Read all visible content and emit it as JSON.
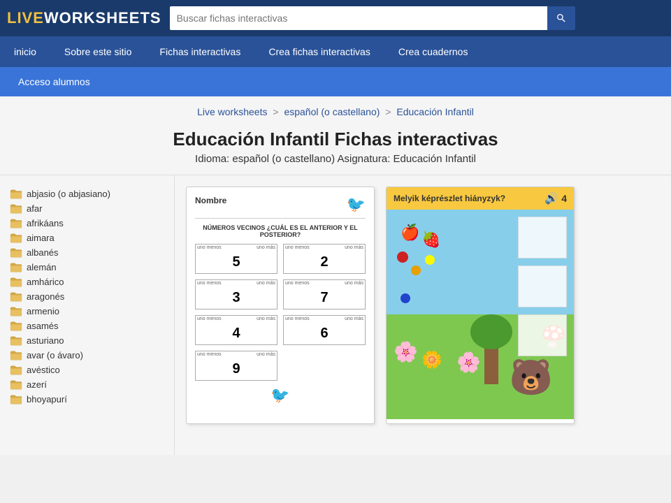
{
  "header": {
    "logo_live": "LIVE",
    "logo_rest": "WORKSHEETS",
    "search_placeholder": "Buscar fichas interactivas"
  },
  "nav": {
    "items": [
      {
        "label": "inicio"
      },
      {
        "label": "Sobre este sitio"
      },
      {
        "label": "Fichas interactivas"
      },
      {
        "label": "Crea fichas interactivas"
      },
      {
        "label": "Crea cuadernos"
      }
    ]
  },
  "acceso": {
    "label": "Acceso alumnos"
  },
  "breadcrumb": {
    "live_worksheets": "Live worksheets",
    "separator1": ">",
    "espanol": "español (o castellano)",
    "separator2": ">",
    "educacion": "Educación Infantil"
  },
  "page": {
    "title": "Educación Infantil Fichas interactivas",
    "subtitle": "Idioma: español (o castellano)   Asignatura: Educación Infantil"
  },
  "sidebar": {
    "items": [
      {
        "label": "abjasio (o abjasiano)"
      },
      {
        "label": "afar"
      },
      {
        "label": "afrikáans"
      },
      {
        "label": "aimara"
      },
      {
        "label": "albanés"
      },
      {
        "label": "alemán"
      },
      {
        "label": "amhárico"
      },
      {
        "label": "aragonés"
      },
      {
        "label": "armenio"
      },
      {
        "label": "asamés"
      },
      {
        "label": "asturiano"
      },
      {
        "label": "avar (o ávaro)"
      },
      {
        "label": "avéstico"
      },
      {
        "label": "azerí"
      },
      {
        "label": "bhoyapurí"
      }
    ]
  },
  "worksheet1": {
    "title": "Nombre",
    "subtitle": "NÚMEROS VECINOS ¿CUÁL ES EL ANTERIOR Y EL POSTERIOR?",
    "cells": [
      {
        "label_left": "uno menos",
        "label_right": "uno más",
        "number": "5"
      },
      {
        "label_left": "uno menos",
        "label_right": "uno más",
        "number": "2"
      },
      {
        "label_left": "uno menos",
        "label_right": "uno más",
        "number": "3"
      },
      {
        "label_left": "uno menos",
        "label_right": "uno más",
        "number": "7"
      },
      {
        "label_left": "uno menos",
        "label_right": "uno más",
        "number": "4"
      },
      {
        "label_left": "uno menos",
        "label_right": "uno más",
        "number": "6"
      },
      {
        "label_left": "uno menos",
        "label_right": "uno más",
        "number": "9"
      }
    ]
  },
  "worksheet2": {
    "header_title": "Melyik képrészlet hiányzyk?",
    "score": "4"
  },
  "icons": {
    "search": "🔍",
    "folder": "📁",
    "speaker": "🔊",
    "bird": "🐦"
  }
}
